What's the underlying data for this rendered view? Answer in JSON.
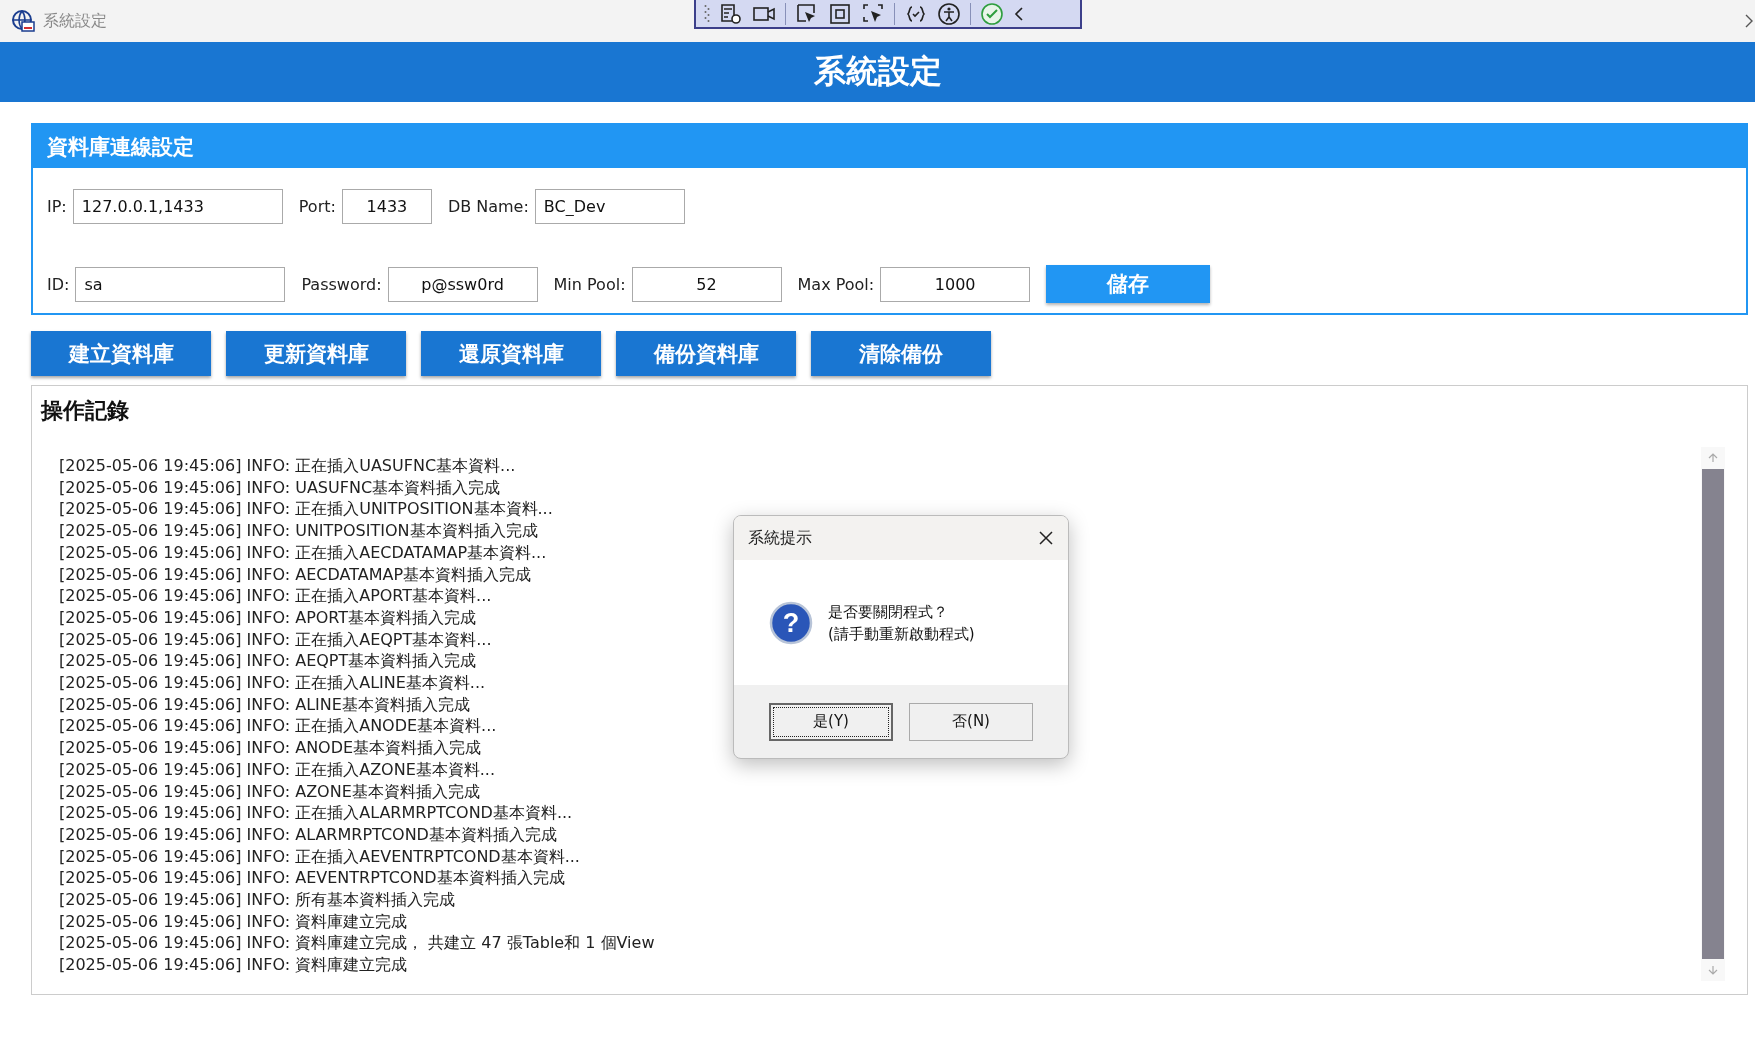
{
  "window": {
    "title": "系統設定"
  },
  "header": {
    "title": "系統設定"
  },
  "connection": {
    "title": "資料庫連線設定",
    "rows": [
      [
        {
          "label": "IP:",
          "value": "127.0.0.1,1433"
        },
        {
          "label": "Port:",
          "value": "1433"
        },
        {
          "label": "DB Name:",
          "value": "BC_Dev"
        }
      ],
      [
        {
          "label": "ID:",
          "value": "sa"
        },
        {
          "label": "Password:",
          "value": "p@ssw0rd"
        },
        {
          "label": "Min Pool:",
          "value": "52"
        },
        {
          "label": "Max Pool:",
          "value": "1000"
        }
      ]
    ],
    "save_button": "儲存"
  },
  "actions": [
    "建立資料庫",
    "更新資料庫",
    "還原資料庫",
    "備份資料庫",
    "清除備份"
  ],
  "log": {
    "title": "操作記錄",
    "lines": [
      "[2025-05-06 19:45:06] INFO: 正在插入UASUFNC基本資料...",
      "[2025-05-06 19:45:06] INFO: UASUFNC基本資料插入完成",
      "[2025-05-06 19:45:06] INFO: 正在插入UNITPOSITION基本資料...",
      "[2025-05-06 19:45:06] INFO: UNITPOSITION基本資料插入完成",
      "[2025-05-06 19:45:06] INFO: 正在插入AECDATAMAP基本資料...",
      "[2025-05-06 19:45:06] INFO: AECDATAMAP基本資料插入完成",
      "[2025-05-06 19:45:06] INFO: 正在插入APORT基本資料...",
      "[2025-05-06 19:45:06] INFO: APORT基本資料插入完成",
      "[2025-05-06 19:45:06] INFO: 正在插入AEQPT基本資料...",
      "[2025-05-06 19:45:06] INFO: AEQPT基本資料插入完成",
      "[2025-05-06 19:45:06] INFO: 正在插入ALINE基本資料...",
      "[2025-05-06 19:45:06] INFO: ALINE基本資料插入完成",
      "[2025-05-06 19:45:06] INFO: 正在插入ANODE基本資料...",
      "[2025-05-06 19:45:06] INFO: ANODE基本資料插入完成",
      "[2025-05-06 19:45:06] INFO: 正在插入AZONE基本資料...",
      "[2025-05-06 19:45:06] INFO: AZONE基本資料插入完成",
      "[2025-05-06 19:45:06] INFO: 正在插入ALARMRPTCOND基本資料...",
      "[2025-05-06 19:45:06] INFO: ALARMRPTCOND基本資料插入完成",
      "[2025-05-06 19:45:06] INFO: 正在插入AEVENTRPTCOND基本資料...",
      "[2025-05-06 19:45:06] INFO: AEVENTRPTCOND基本資料插入完成",
      "[2025-05-06 19:45:06] INFO: 所有基本資料插入完成",
      "[2025-05-06 19:45:06] INFO: 資料庫建立完成",
      "[2025-05-06 19:45:06] INFO: 資料庫建立完成， 共建立 47 張Table和 1 個View",
      "[2025-05-06 19:45:06] INFO: 資料庫建立完成"
    ]
  },
  "dialog": {
    "title": "系統提示",
    "icon": "?",
    "message": [
      "是否要關閉程式？",
      "(請手動重新啟動程式)"
    ],
    "buttons": [
      {
        "label": "是(Y)",
        "focused": true
      },
      {
        "label": "否(N)",
        "focused": false
      }
    ]
  }
}
